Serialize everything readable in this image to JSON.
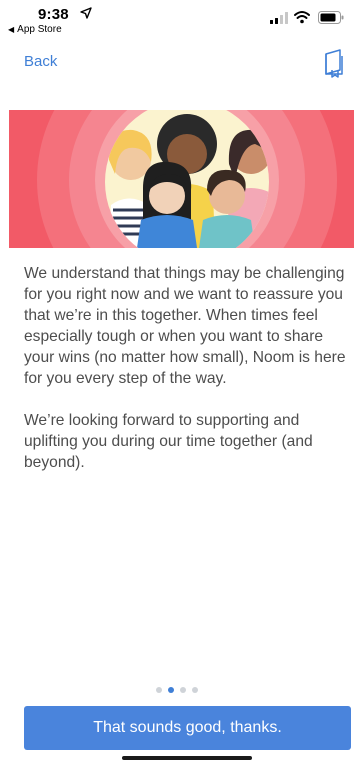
{
  "status_bar": {
    "time": "9:38",
    "back_to_app": "App Store",
    "icons": [
      "location-arrow-icon",
      "cellular-signal-icon",
      "wifi-icon",
      "battery-icon"
    ]
  },
  "nav": {
    "back_label": "Back",
    "right_icon": "book-icon"
  },
  "hero": {
    "background_color": "#f25a67",
    "illustration": "group-of-five-diverse-people"
  },
  "content": {
    "paragraphs": [
      "We understand that things may be challenging for you right now and we want to reassure you that we’re in this together. When times feel especially tough or when you want to share your wins (no matter how small), Noom is here for you every step of the way.",
      "We’re looking forward to supporting and uplifting you during our time together (and beyond)."
    ]
  },
  "pagination": {
    "total": 4,
    "current": 2
  },
  "cta": {
    "label": "That sounds good, thanks.",
    "color": "#4a84dc"
  },
  "colors": {
    "accent": "#3f7fd6",
    "text": "#4d4d4d"
  }
}
